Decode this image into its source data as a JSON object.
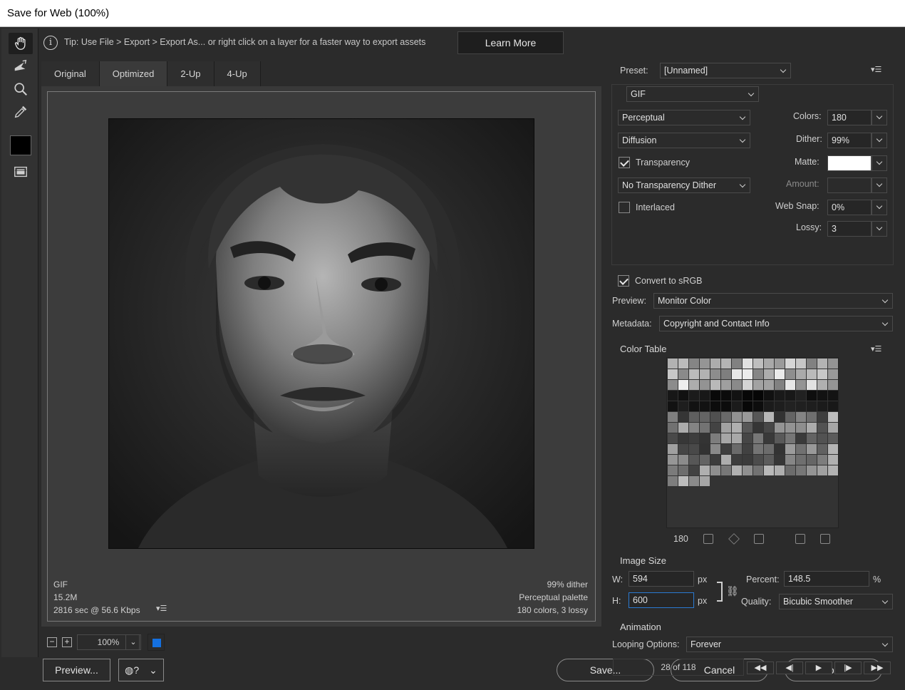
{
  "window": {
    "title": "Save for Web (100%)"
  },
  "tip": {
    "text": "Tip: Use File > Export > Export As...  or right click on a layer for a faster way to export assets",
    "learn_more": "Learn More"
  },
  "tabs": [
    "Original",
    "Optimized",
    "2-Up",
    "4-Up"
  ],
  "image_info": {
    "format": "GIF",
    "size": "15.2M",
    "time": "2816 sec @ 56.6 Kbps",
    "dither": "99% dither",
    "palette": "Perceptual palette",
    "colors": "180 colors, 3 lossy"
  },
  "zoom": {
    "value": "100%"
  },
  "buttons": {
    "preview": "Preview...",
    "save": "Save...",
    "cancel": "Cancel",
    "done": "Done"
  },
  "settings": {
    "preset_label": "Preset:",
    "preset_value": "[Unnamed]",
    "format": "GIF",
    "reduction": "Perceptual",
    "dither_algo": "Diffusion",
    "transparency_label": "Transparency",
    "transparency_checked": true,
    "transparency_dither": "No Transparency Dither",
    "interlaced_label": "Interlaced",
    "interlaced_checked": false,
    "colors_label": "Colors:",
    "colors_value": "180",
    "dither_label": "Dither:",
    "dither_value": "99%",
    "matte_label": "Matte:",
    "amount_label": "Amount:",
    "websnap_label": "Web Snap:",
    "websnap_value": "0%",
    "lossy_label": "Lossy:",
    "lossy_value": "3",
    "convert_srgb_label": "Convert to sRGB",
    "convert_srgb_checked": true,
    "preview_label": "Preview:",
    "preview_value": "Monitor Color",
    "metadata_label": "Metadata:",
    "metadata_value": "Copyright and Contact Info"
  },
  "color_table": {
    "title": "Color Table",
    "count": "180"
  },
  "image_size": {
    "title": "Image Size",
    "w_label": "W:",
    "w_value": "594",
    "h_label": "H:",
    "h_value": "600",
    "unit": "px",
    "percent_label": "Percent:",
    "percent_value": "148.5",
    "percent_unit": "%",
    "quality_label": "Quality:",
    "quality_value": "Bicubic Smoother"
  },
  "animation": {
    "title": "Animation",
    "looping_label": "Looping Options:",
    "looping_value": "Forever",
    "frame": "28 of 118"
  },
  "colors": {
    "accent_blue": "#1470e0",
    "background": "#2b2b2b"
  }
}
